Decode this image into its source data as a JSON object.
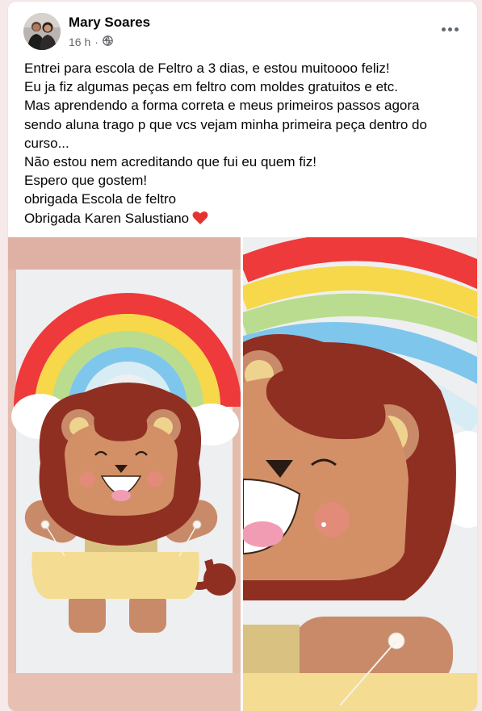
{
  "post": {
    "author": "Mary Soares",
    "time": "16 h",
    "separator": "·",
    "audience_icon": "globe-icon",
    "more_icon": "more-options-icon",
    "lines": [
      "Entrei para escola de Feltro a 3 dias, e estou muitoooo feliz!",
      "Eu ja fiz algumas peças em feltro com moldes gratuitos e etc.",
      "Mas  aprendendo a forma correta e meus primeiros passos agora",
      "sendo aluna trago p que vcs vejam minha primeira peça dentro do",
      "curso...",
      "Não estou nem acreditando que fui eu quem fiz!",
      "Espero que gostem!",
      "obrigada Escola de feltro",
      "Obrigada Karen Salustiano"
    ],
    "last_line_emoji": "heart-emoji",
    "photos": [
      "felt-lion-rainbow-full",
      "felt-lion-rainbow-closeup"
    ]
  },
  "colors": {
    "heart": "#e4332f",
    "text": "#050505",
    "meta": "#65676b",
    "felt_red": "#ee3a3a",
    "felt_yellow": "#f6d84a",
    "felt_green": "#b9dc8e",
    "felt_blue": "#7ec6ec",
    "felt_lightblue": "#d7ecf5",
    "lion_mane": "#8f2f22",
    "lion_face": "#d39067",
    "lion_belt": "#f4dc92"
  }
}
